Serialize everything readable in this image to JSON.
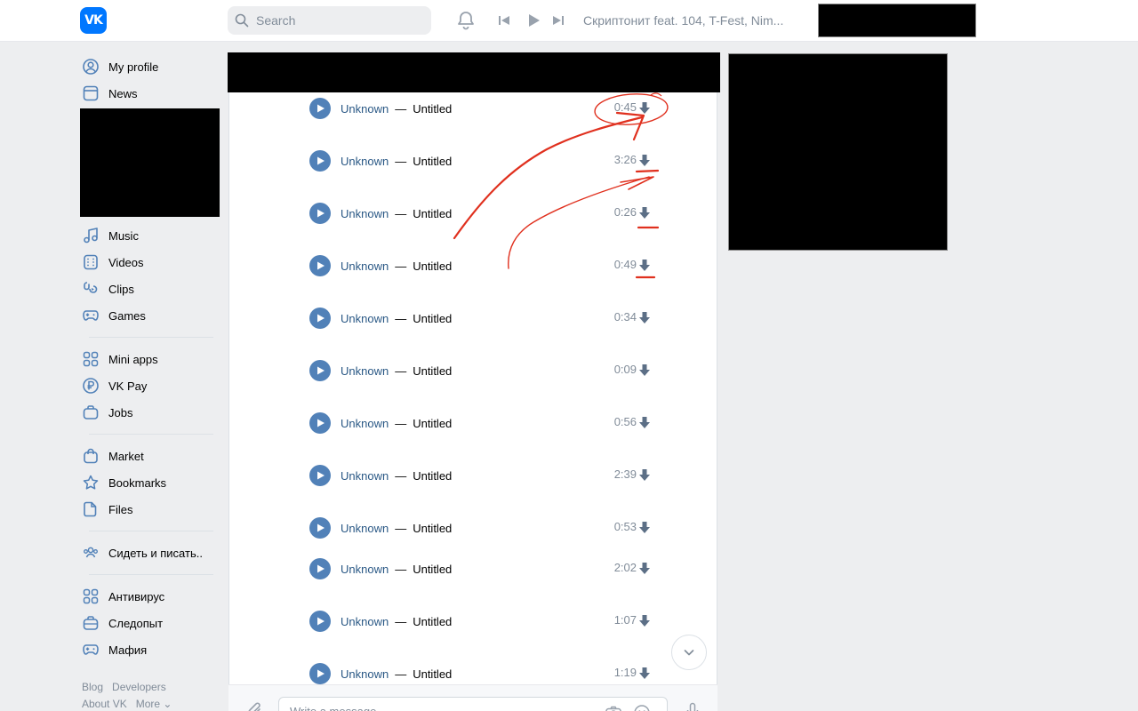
{
  "header": {
    "logo_text": "VK",
    "search_placeholder": "Search",
    "now_playing": "Скриптонит feat. 104, T-Fest, Nim..."
  },
  "sidebar": {
    "group1": [
      {
        "label": "My profile",
        "icon": "user-circle-icon"
      },
      {
        "label": "News",
        "icon": "newsfeed-icon"
      }
    ],
    "group2": [
      {
        "label": "Music",
        "icon": "music-icon"
      },
      {
        "label": "Videos",
        "icon": "video-icon"
      },
      {
        "label": "Clips",
        "icon": "clips-icon"
      },
      {
        "label": "Games",
        "icon": "gamepad-icon"
      }
    ],
    "group3": [
      {
        "label": "Mini apps",
        "icon": "apps-icon"
      },
      {
        "label": "VK Pay",
        "icon": "ruble-icon"
      },
      {
        "label": "Jobs",
        "icon": "briefcase-icon"
      }
    ],
    "group4": [
      {
        "label": "Market",
        "icon": "bag-icon"
      },
      {
        "label": "Bookmarks",
        "icon": "star-icon"
      },
      {
        "label": "Files",
        "icon": "file-icon"
      }
    ],
    "group5": [
      {
        "label": "Сидеть и писать..",
        "icon": "users-icon"
      }
    ],
    "group6": [
      {
        "label": "Антивирус",
        "icon": "apps-icon"
      },
      {
        "label": "Следопыт",
        "icon": "briefcase-icon"
      },
      {
        "label": "Мафия",
        "icon": "gamepad-icon"
      }
    ],
    "footer": {
      "blog": "Blog",
      "developers": "Developers",
      "about": "About VK",
      "more": "More ⌄"
    }
  },
  "tracks": [
    {
      "artist": "Unknown",
      "separator": "—",
      "title": "Untitled",
      "duration": "0:45"
    },
    {
      "artist": "Unknown",
      "separator": "—",
      "title": "Untitled",
      "duration": "3:26"
    },
    {
      "artist": "Unknown",
      "separator": "—",
      "title": "Untitled",
      "duration": "0:26"
    },
    {
      "artist": "Unknown",
      "separator": "—",
      "title": "Untitled",
      "duration": "0:49"
    },
    {
      "artist": "Unknown",
      "separator": "—",
      "title": "Untitled",
      "duration": "0:34"
    },
    {
      "artist": "Unknown",
      "separator": "—",
      "title": "Untitled",
      "duration": "0:09"
    },
    {
      "artist": "Unknown",
      "separator": "—",
      "title": "Untitled",
      "duration": "0:56"
    },
    {
      "artist": "Unknown",
      "separator": "—",
      "title": "Untitled",
      "duration": "2:39"
    },
    {
      "artist": "Unknown",
      "separator": "—",
      "title": "Untitled",
      "duration": "0:53"
    },
    {
      "artist": "Unknown",
      "separator": "—",
      "title": "Untitled",
      "duration": "2:02"
    },
    {
      "artist": "Unknown",
      "separator": "—",
      "title": "Untitled",
      "duration": "1:07"
    },
    {
      "artist": "Unknown",
      "separator": "—",
      "title": "Untitled",
      "duration": "1:19"
    }
  ],
  "composer": {
    "placeholder": "Write a message..."
  },
  "colors": {
    "accent": "#0077ff",
    "play_button": "#5181b8",
    "link": "#2a5885",
    "muted": "#818c99",
    "annotation": "#e0301e"
  }
}
